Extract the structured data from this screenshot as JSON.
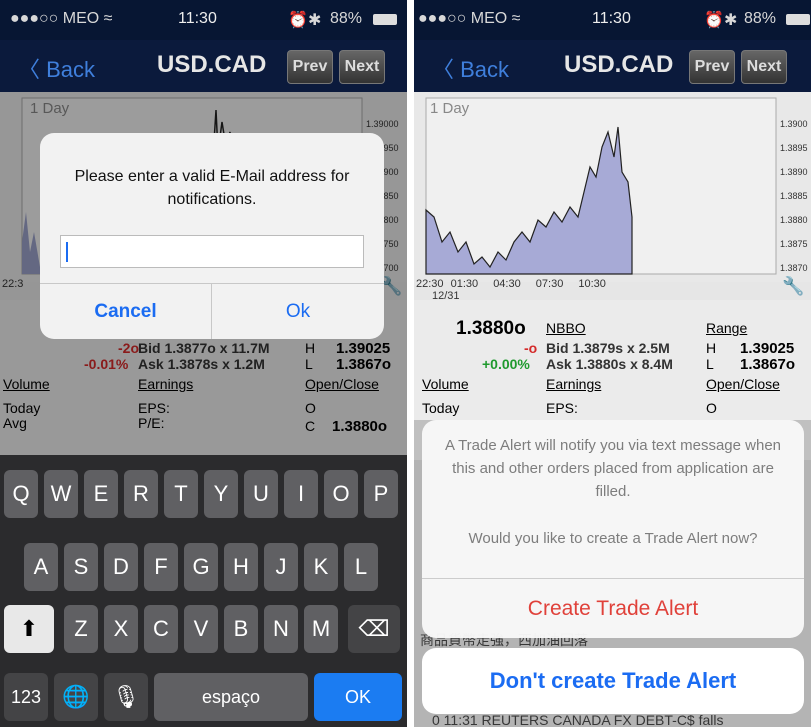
{
  "left": {
    "status": {
      "carrier": "●●●○○ MEO ≈",
      "time": "11:30",
      "battery": "88%"
    },
    "nav": {
      "back": "〈 Back",
      "title": "USD.CAD",
      "prev": "Prev",
      "next": "Next"
    },
    "chart": {
      "period_label": "1 Day",
      "price_ticks": [
        "1.39000",
        "1.38950",
        "1.38900",
        "1.38850",
        "1.38800",
        "1.38750",
        "1.38700"
      ],
      "time_start": "22:3"
    },
    "quote": {
      "change": "-2o",
      "change_pct": "-0.01%",
      "bid": "Bid 1.3877o x 11.7M",
      "ask": "Ask 1.3878s x 1.2M",
      "high_label": "H",
      "high": "1.39025",
      "low_label": "L",
      "low": "1.3867o",
      "volume_label": "Volume",
      "earnings_label": "Earnings",
      "open_close_label": "Open/Close",
      "today_label": "Today",
      "avg_label": "Avg",
      "eps_label": "EPS:",
      "pe_label": "P/E:",
      "open_label": "O",
      "close_label": "C",
      "close_value": "1.3880o"
    },
    "alert": {
      "message": "Please enter a valid E-Mail address for notifications.",
      "input_value": "",
      "cancel": "Cancel",
      "ok": "Ok"
    },
    "keyboard": {
      "row1": [
        "Q",
        "W",
        "E",
        "R",
        "T",
        "Y",
        "U",
        "I",
        "O",
        "P"
      ],
      "row2": [
        "A",
        "S",
        "D",
        "F",
        "G",
        "H",
        "J",
        "K",
        "L"
      ],
      "row3": [
        "Z",
        "X",
        "C",
        "V",
        "B",
        "N",
        "M"
      ],
      "shift_icon": "shift-icon",
      "delete_icon": "delete-icon",
      "numbers": "123",
      "globe_icon": "globe-icon",
      "mic_icon": "microphone-icon",
      "space": "espaço",
      "ok": "OK"
    }
  },
  "right": {
    "status": {
      "carrier": "●●●○○ MEO ≈",
      "time": "11:30",
      "battery": "88%"
    },
    "nav": {
      "back": "〈 Back",
      "title": "USD.CAD",
      "prev": "Prev",
      "next": "Next"
    },
    "chart": {
      "period_label": "1 Day",
      "price_ticks": [
        "1.3900",
        "1.3895",
        "1.3890",
        "1.3885",
        "1.3880",
        "1.3875",
        "1.3870"
      ],
      "time_ticks": [
        "22:30",
        "01:30",
        "04:30",
        "07:30",
        "10:30"
      ],
      "date": "12/31"
    },
    "quote": {
      "last": "1.3880o",
      "nbbo_label": "NBBO",
      "range_label": "Range",
      "change": "-o",
      "change_pct": "+0.00%",
      "bid": "Bid 1.3879s x 2.5M",
      "ask": "Ask 1.3880s x 8.4M",
      "high_label": "H",
      "high": "1.39025",
      "low_label": "L",
      "low": "1.3867o",
      "volume_label": "Volume",
      "earnings_label": "Earnings",
      "open_close_label": "Open/Close",
      "today_label": "Today",
      "eps_label": "EPS:",
      "open_label": "O"
    },
    "sheet": {
      "message": "A Trade Alert will notify you via text message when this and other orders placed from application are filled.",
      "question": "Would you like to create a Trade Alert now?",
      "create": "Create Trade Alert",
      "dont_create": "Don't create Trade Alert"
    },
    "behind": {
      "news_fragment": "商品貨幣走強，西加油回落",
      "headline": "0 11:31 REUTERS CANADA FX DEBT-C$ falls"
    },
    "colors": {
      "accent": "#1b6cf2",
      "danger": "#e0413a",
      "positive": "#1f9a2e",
      "negative": "#d42a2a",
      "nav_bg": "#0b1a3c"
    }
  }
}
